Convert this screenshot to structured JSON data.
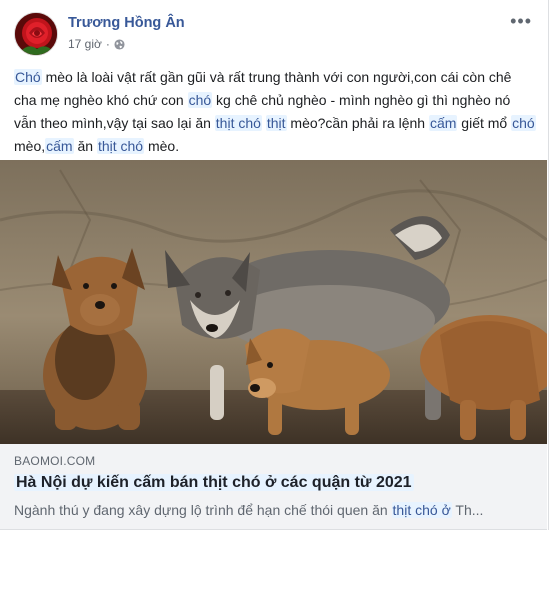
{
  "post": {
    "author": "Trương Hồng Ân",
    "time": "17 giờ",
    "privacy_icon": "globe-icon",
    "more_icon": "more-icon",
    "text_segments": [
      {
        "t": "Chó",
        "hl": true
      },
      {
        "t": " mèo là loài vật rất gần gũi và rất trung thành với con người,con cái còn chê cha mẹ nghèo khó chứ con ",
        "hl": false
      },
      {
        "t": "chó",
        "hl": true
      },
      {
        "t": " kg chê chủ nghèo - mình nghèo gì thì nghèo nó vẫn theo mình,vậy tại sao lại ăn ",
        "hl": false
      },
      {
        "t": "thịt chó",
        "hl": true
      },
      {
        "t": " ",
        "hl": false
      },
      {
        "t": "thịt",
        "hl": true
      },
      {
        "t": " mèo?cần phải ra lệnh ",
        "hl": false
      },
      {
        "t": "cấm",
        "hl": true
      },
      {
        "t": " giết mổ ",
        "hl": false
      },
      {
        "t": "chó",
        "hl": true
      },
      {
        "t": " mèo,",
        "hl": false
      },
      {
        "t": "cấm",
        "hl": true
      },
      {
        "t": " ăn ",
        "hl": false
      },
      {
        "t": "thịt chó",
        "hl": true
      },
      {
        "t": " mèo.",
        "hl": false
      }
    ]
  },
  "link_preview": {
    "domain": "BAOMOI.COM",
    "title": "Hà Nội dự kiến cấm bán thịt chó ở các quận từ 2021",
    "desc_prefix": "Ngành thú y đang xây dựng lộ trình để hạn chế thói quen ăn ",
    "desc_highlight": "thịt chó ở",
    "desc_suffix": " Th..."
  },
  "colors": {
    "author": "#385898",
    "highlight_bg": "#e7f3ff",
    "link_box_bg": "#f2f3f5"
  }
}
